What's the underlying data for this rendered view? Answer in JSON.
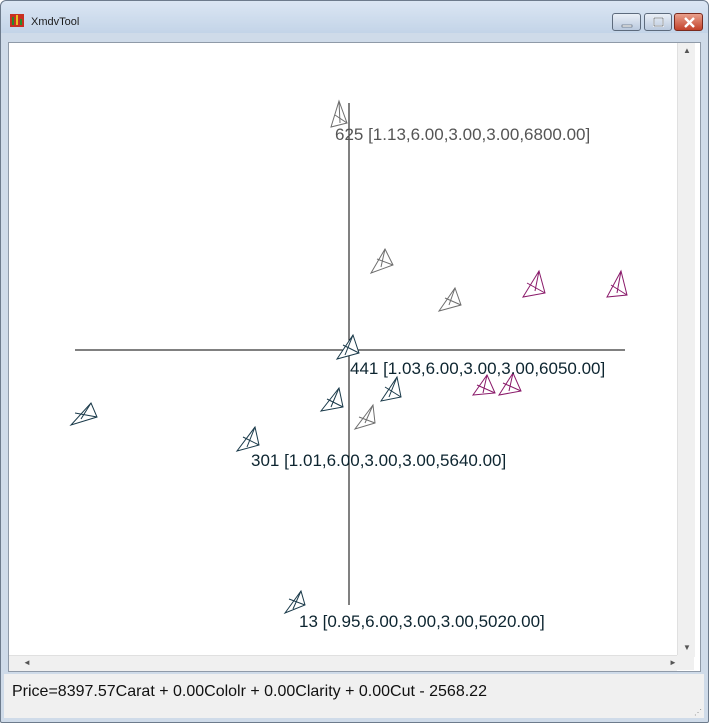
{
  "window": {
    "title": "XmdvTool",
    "minimize_icon": "minimize-icon",
    "maximize_icon": "maximize-icon",
    "close_icon": "close-icon"
  },
  "plot": {
    "glyph_outline_colors": {
      "dark": "#1a3a4a",
      "gray": "#6e6e6e",
      "magenta": "#8a1a6a"
    },
    "axis_color": "#000000",
    "labels": {
      "p625": "625 [1.13,6.00,3.00,3.00,6800.00]",
      "p441": "441 [1.03,6.00,3.00,3.00,6050.00]",
      "p301": "301 [1.01,6.00,3.00,3.00,5640.00]",
      "p13": "13 [0.95,6.00,3.00,3.00,5020.00]"
    }
  },
  "scrollbars": {
    "up_arrow": "▲",
    "down_arrow": "▼",
    "left_arrow": "◄",
    "right_arrow": "►"
  },
  "status": {
    "formula": "Price=8397.57Carat + 0.00Cololr + 0.00Clarity + 0.00Cut - 2568.22"
  }
}
